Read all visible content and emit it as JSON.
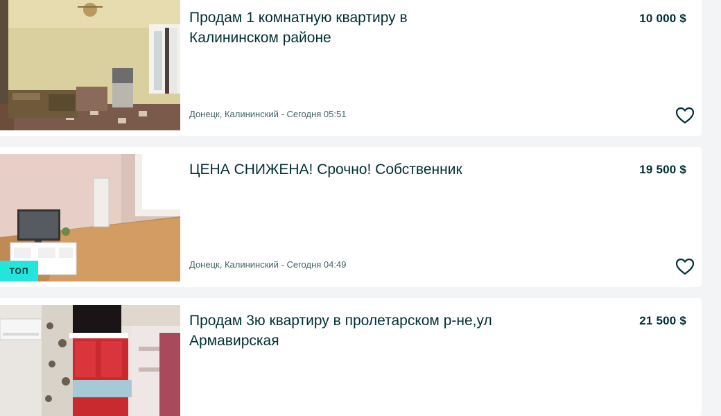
{
  "listings": [
    {
      "title": "Продам 1 комнатную квартиру в Калининском районе",
      "price": "10 000 $",
      "location_time": "Донецк, Калининский - Сегодня 05:51",
      "badge": ""
    },
    {
      "title": "ЦЕНА СНИЖЕНА! Срочно! Собственник",
      "price": "19 500 $",
      "location_time": "Донецк, Калининский - Сегодня 04:49",
      "badge": "ТОП"
    },
    {
      "title": "Продам 3ю квартиру в пролетарском р-не,ул Армавирская",
      "price": "21 500 $",
      "location_time": "",
      "badge": ""
    }
  ],
  "icons": {
    "favorite": "heart-outline-icon"
  },
  "colors": {
    "card_bg": "#ffffff",
    "page_bg": "#f2f4f5",
    "text": "#002f34",
    "meta_text": "#406367",
    "top_badge": "#23e5db"
  }
}
